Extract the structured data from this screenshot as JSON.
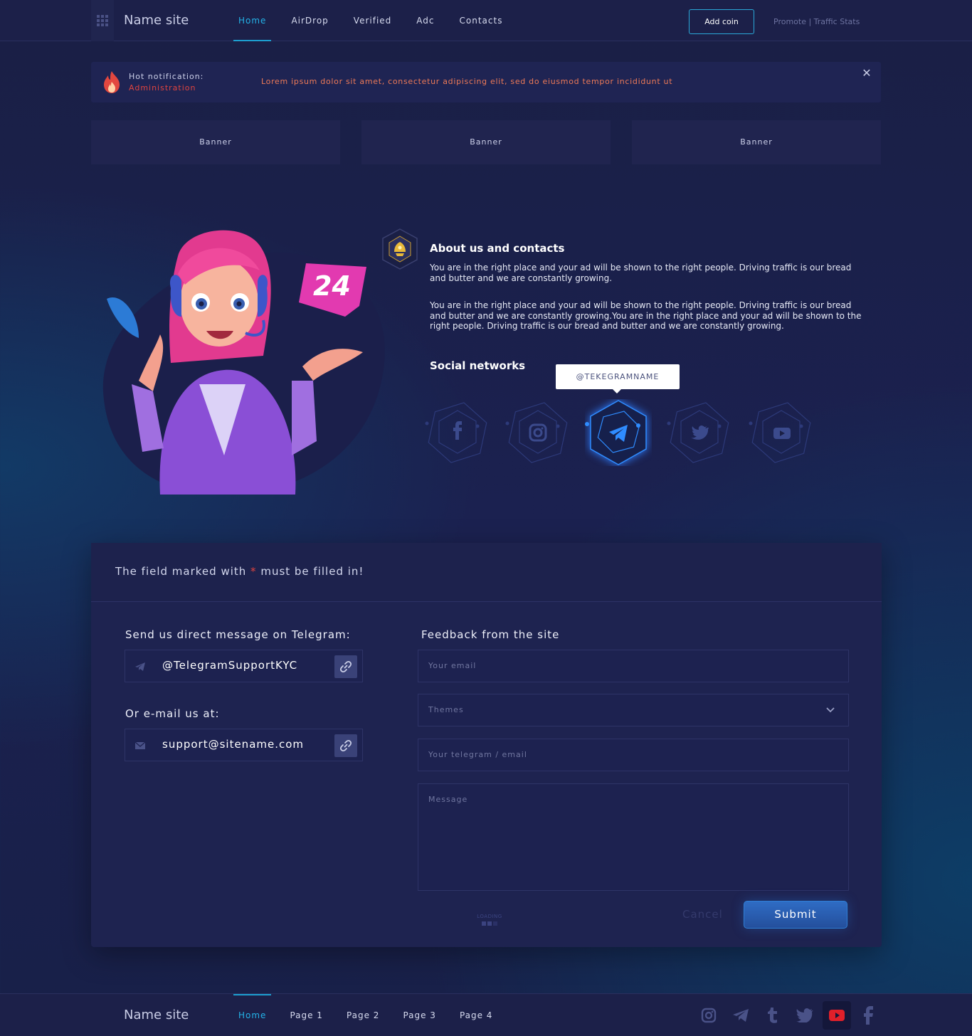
{
  "header": {
    "site_name": "Name site",
    "nav": [
      "Home",
      "AirDrop",
      "Verified",
      "Adc",
      "Contacts"
    ],
    "add_coin": "Add coin",
    "promote": "Promote | Traffic Stats"
  },
  "notification": {
    "title": "Hot notification:",
    "sender": "Administration",
    "message": "Lorem ipsum dolor sit amet, consectetur adipiscing elit, sed do eiusmod tempor incididunt ut"
  },
  "banners": [
    "Banner",
    "Banner",
    "Banner"
  ],
  "about": {
    "title": "About us and contacts",
    "paragraph1": "You are in the right place and your ad will be shown to the right people. Driving traffic is our bread and butter and we are constantly growing.",
    "paragraph2": "You are in the right place and your ad will be shown to the right people. Driving traffic is our bread and butter and we are constantly growing.You are in the right place and your ad will be shown to the right people. Driving traffic is our bread and butter and we are constantly growing.",
    "social_title": "Social networks",
    "tooltip": "@TEKEGRAMNAME",
    "social_icons": [
      "facebook-icon",
      "instagram-icon",
      "telegram-icon",
      "twitter-icon",
      "youtube-icon"
    ],
    "active_social": "telegram-icon",
    "illustration_badge": "24"
  },
  "form": {
    "notice_before": "The field marked with",
    "notice_star": "*",
    "notice_after": "must be filled in!",
    "telegram_label": "Send us direct message on Telegram:",
    "telegram_value": "@TelegramSupportKYC",
    "email_label": "Or e-mail us at:",
    "email_value": "support@sitename.com",
    "feedback_title": "Feedback from the site",
    "email_placeholder": "Your email",
    "themes_placeholder": "Themes",
    "contact_placeholder": "Your telegram / email",
    "message_placeholder": "Message",
    "loading": "LOADING",
    "cancel": "Cancel",
    "submit": "Submit"
  },
  "footer": {
    "site_name": "Name site",
    "nav": [
      "Home",
      "Page 1",
      "Page 2",
      "Page 3",
      "Page 4"
    ],
    "icons": [
      "instagram-icon",
      "telegram-icon",
      "tumblr-icon",
      "twitter-icon",
      "youtube-icon",
      "facebook-icon"
    ],
    "active_icon": "youtube-icon"
  },
  "colors": {
    "accent": "#24b3e8",
    "alert": "#e0443f",
    "notification_text": "#ee7a57",
    "submit": "#2f6cc4",
    "youtube": "#e0202a"
  }
}
